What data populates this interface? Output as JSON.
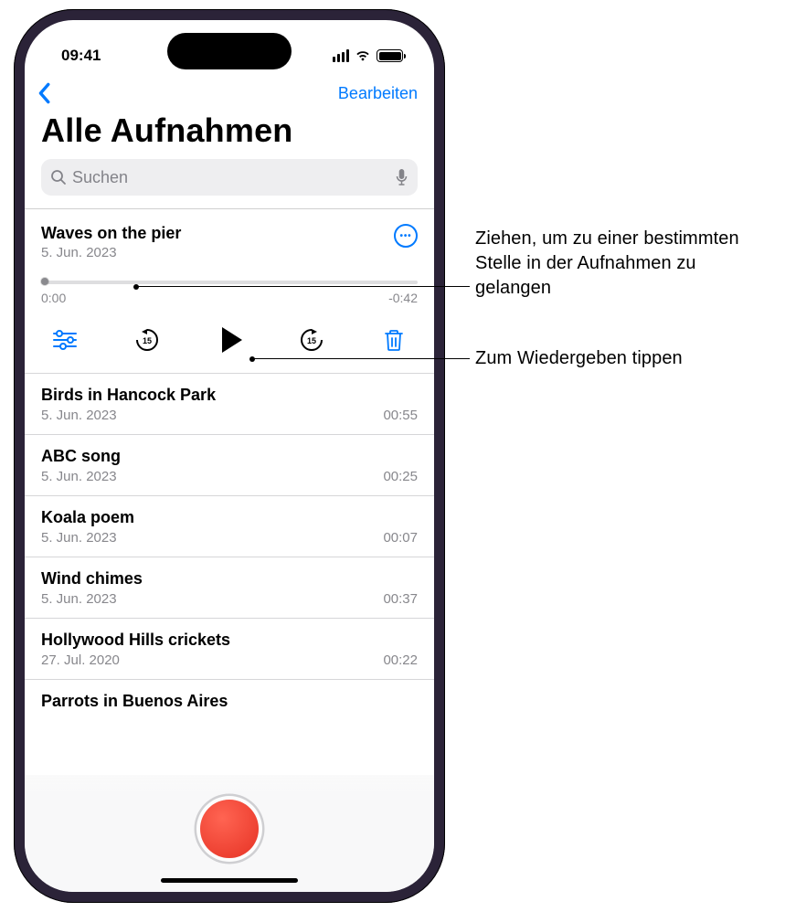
{
  "status": {
    "time": "09:41"
  },
  "nav": {
    "edit": "Bearbeiten"
  },
  "title": "Alle Aufnahmen",
  "search": {
    "placeholder": "Suchen"
  },
  "expanded": {
    "title": "Waves on the pier",
    "date": "5. Jun. 2023",
    "elapsed": "0:00",
    "remaining": "-0:42"
  },
  "recordings": [
    {
      "title": "Birds in Hancock Park",
      "date": "5. Jun. 2023",
      "duration": "00:55"
    },
    {
      "title": "ABC song",
      "date": "5. Jun. 2023",
      "duration": "00:25"
    },
    {
      "title": "Koala poem",
      "date": "5. Jun. 2023",
      "duration": "00:07"
    },
    {
      "title": "Wind chimes",
      "date": "5. Jun. 2023",
      "duration": "00:37"
    },
    {
      "title": "Hollywood Hills crickets",
      "date": "27. Jul. 2020",
      "duration": "00:22"
    },
    {
      "title": "Parrots in Buenos Aires",
      "date": "",
      "duration": ""
    }
  ],
  "callouts": {
    "scrub": "Ziehen, um zu einer bestimmten Stelle in der Aufnahmen zu gelangen",
    "play": "Zum Wiedergeben tippen"
  }
}
